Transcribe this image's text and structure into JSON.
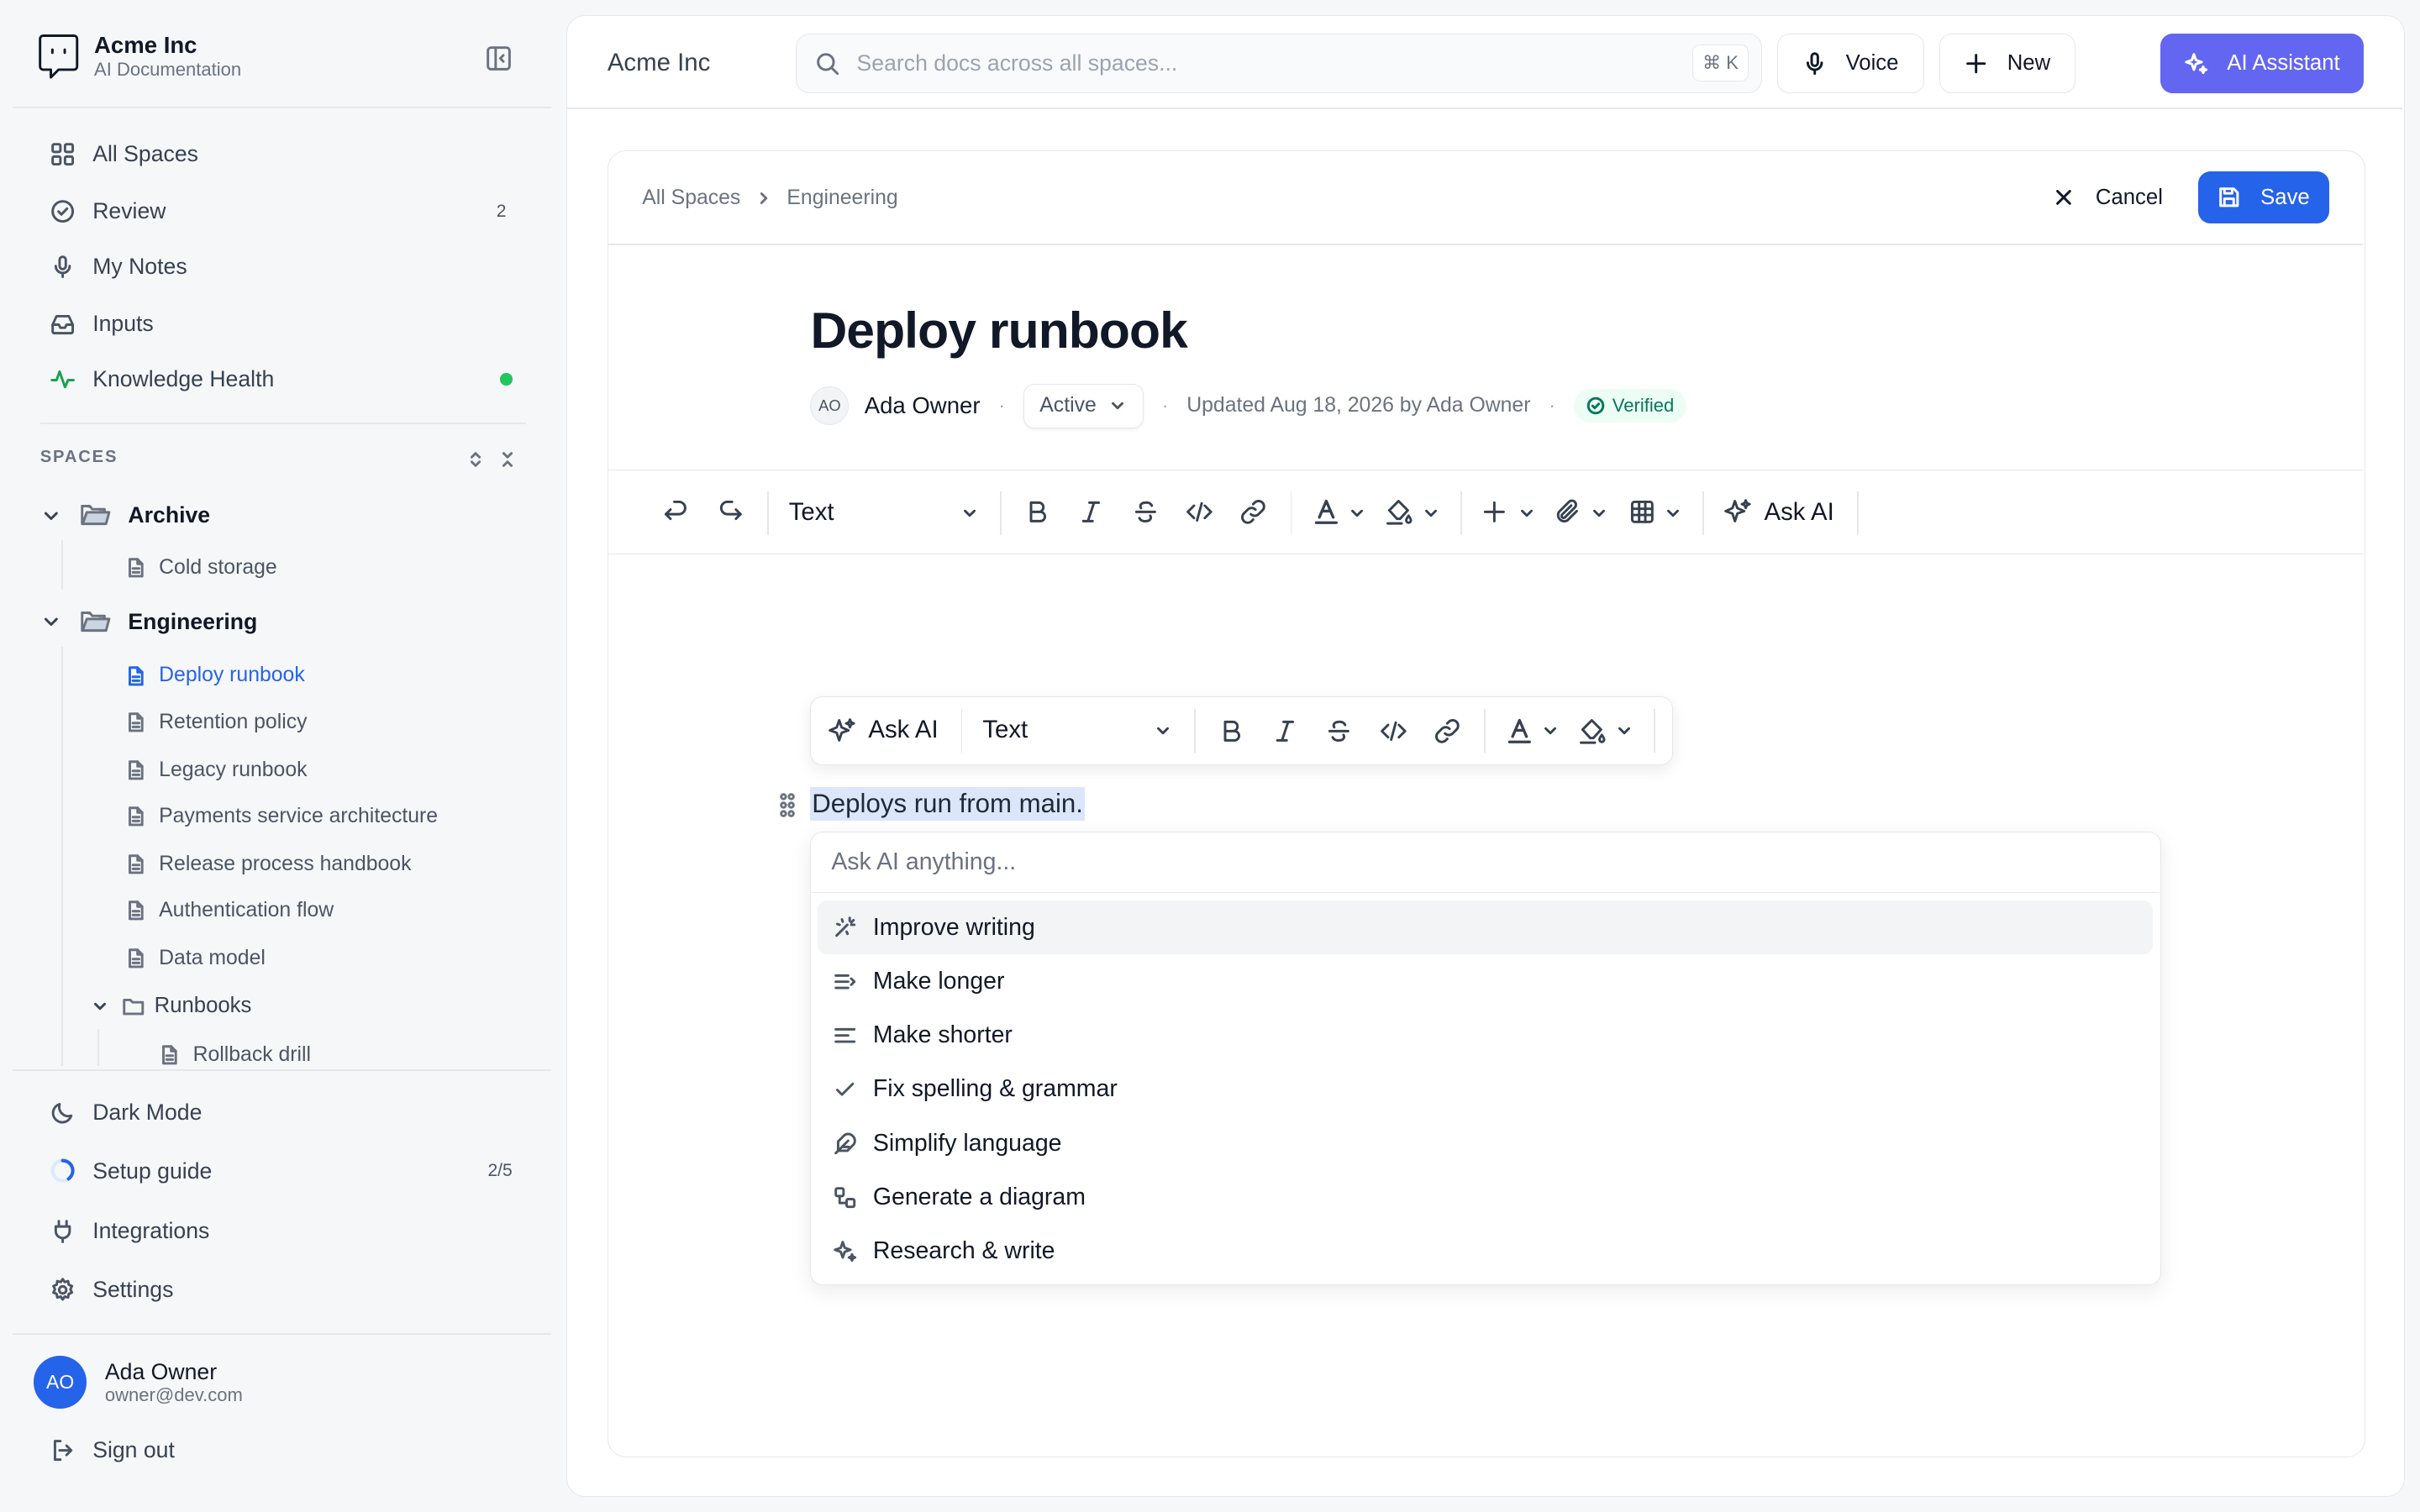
{
  "brand": {
    "name": "Acme Inc",
    "subtitle": "AI Documentation"
  },
  "nav": [
    {
      "label": "All Spaces",
      "icon": "grid-icon"
    },
    {
      "label": "Review",
      "icon": "check-circle-icon",
      "count": "2"
    },
    {
      "label": "My Notes",
      "icon": "mic-icon"
    },
    {
      "label": "Inputs",
      "icon": "inbox-icon"
    },
    {
      "label": "Knowledge Health",
      "icon": "activity-icon",
      "status_color": "#22c55e"
    }
  ],
  "spaces": {
    "label": "SPACES",
    "archive": {
      "name": "Archive",
      "children": [
        "Cold storage"
      ]
    },
    "engineering": {
      "name": "Engineering",
      "docs": [
        "Deploy runbook",
        "Retention policy",
        "Legacy runbook",
        "Payments service architecture",
        "Release process handbook",
        "Authentication flow",
        "Data model"
      ],
      "active_doc": "Deploy runbook",
      "subfolder": {
        "name": "Runbooks",
        "children": [
          "Rollback drill"
        ]
      }
    }
  },
  "bottom_nav": [
    {
      "label": "Dark Mode",
      "icon": "moon-icon"
    },
    {
      "label": "Setup guide",
      "icon": "progress-ring-icon",
      "progress": "2/5"
    },
    {
      "label": "Integrations",
      "icon": "plug-icon"
    },
    {
      "label": "Settings",
      "icon": "gear-icon"
    }
  ],
  "user": {
    "initials": "AO",
    "name": "Ada Owner",
    "email": "owner@dev.com",
    "sign_out": "Sign out"
  },
  "topbar": {
    "title": "Acme Inc",
    "search_placeholder": "Search docs across all spaces...",
    "shortcut": "⌘ K",
    "voice": "Voice",
    "new": "New",
    "ai_assistant": "AI Assistant"
  },
  "editor": {
    "breadcrumb": [
      "All Spaces",
      "Engineering"
    ],
    "cancel": "Cancel",
    "save": "Save",
    "title": "Deploy runbook",
    "author_initials": "AO",
    "author": "Ada Owner",
    "status": "Active",
    "updated": "Updated Aug 18, 2026 by Ada Owner",
    "verified": "Verified",
    "toolbar": {
      "block_type": "Text",
      "ask_ai": "Ask AI"
    },
    "bubble": {
      "ask_ai": "Ask AI",
      "block_type": "Text"
    },
    "selected_line": "Deploys run from main.",
    "ai_placeholder": "Ask AI anything...",
    "ai_options": [
      {
        "label": "Improve writing",
        "icon": "magic-wand-icon"
      },
      {
        "label": "Make longer",
        "icon": "text-expand-icon"
      },
      {
        "label": "Make shorter",
        "icon": "text-shorten-icon"
      },
      {
        "label": "Fix spelling & grammar",
        "icon": "check-icon"
      },
      {
        "label": "Simplify language",
        "icon": "feather-icon"
      },
      {
        "label": "Generate a diagram",
        "icon": "diagram-icon"
      },
      {
        "label": "Research & write",
        "icon": "sparkles-icon"
      }
    ]
  },
  "colors": {
    "accent": "#2563eb",
    "ai": "#6366f1",
    "selection": "#dbe6fb",
    "verified": "#047857"
  }
}
